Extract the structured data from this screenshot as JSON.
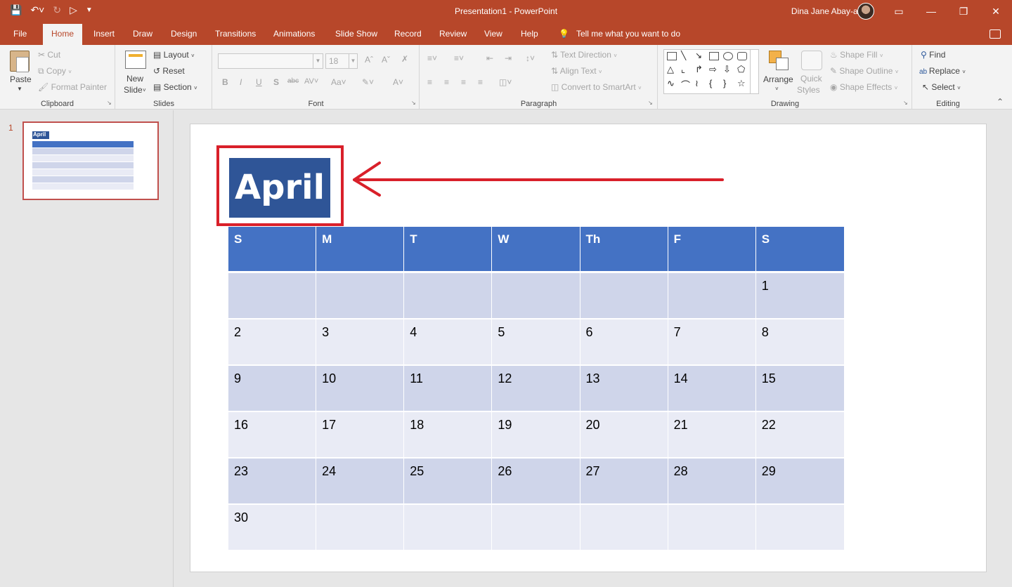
{
  "window": {
    "title": "Presentation1  -  PowerPoint",
    "user": "Dina Jane Abay-abay"
  },
  "tabs": [
    "File",
    "Home",
    "Insert",
    "Draw",
    "Design",
    "Transitions",
    "Animations",
    "Slide Show",
    "Record",
    "Review",
    "View",
    "Help"
  ],
  "tell_me": "Tell me what you want to do",
  "ribbon": {
    "clipboard": {
      "paste": "Paste",
      "cut": "Cut",
      "copy": "Copy",
      "format_painter": "Format Painter",
      "label": "Clipboard"
    },
    "slides": {
      "new_slide_1": "New",
      "new_slide_2": "Slide",
      "layout": "Layout",
      "reset": "Reset",
      "section": "Section",
      "label": "Slides"
    },
    "font": {
      "size": "18",
      "label": "Font"
    },
    "paragraph": {
      "text_direction": "Text Direction",
      "align_text": "Align Text",
      "convert_smartart": "Convert to SmartArt",
      "label": "Paragraph"
    },
    "drawing": {
      "arrange": "Arrange",
      "quick_styles_1": "Quick",
      "quick_styles_2": "Styles",
      "shape_fill": "Shape Fill",
      "shape_outline": "Shape Outline",
      "shape_effects": "Shape Effects",
      "label": "Drawing"
    },
    "editing": {
      "find": "Find",
      "replace": "Replace",
      "select": "Select",
      "label": "Editing"
    }
  },
  "thumbnails": {
    "slide_number": "1",
    "title": "April"
  },
  "slide": {
    "title": "April",
    "calendar": {
      "headers": [
        "S",
        "M",
        "T",
        "W",
        "Th",
        "F",
        "S"
      ],
      "weeks": [
        [
          "",
          "",
          "",
          "",
          "",
          "",
          "1"
        ],
        [
          "2",
          "3",
          "4",
          "5",
          "6",
          "7",
          "8"
        ],
        [
          "9",
          "10",
          "11",
          "12",
          "13",
          "14",
          "15"
        ],
        [
          "16",
          "17",
          "18",
          "19",
          "20",
          "21",
          "22"
        ],
        [
          "23",
          "24",
          "25",
          "26",
          "27",
          "28",
          "29"
        ],
        [
          "30",
          "",
          "",
          "",
          "",
          "",
          ""
        ]
      ]
    }
  },
  "colors": {
    "accent": "#b7472a",
    "table_header": "#4472c4",
    "row_dark": "#cfd5ea",
    "row_light": "#e9ebf5",
    "title_box": "#2f5597",
    "highlight": "#d9202a"
  }
}
